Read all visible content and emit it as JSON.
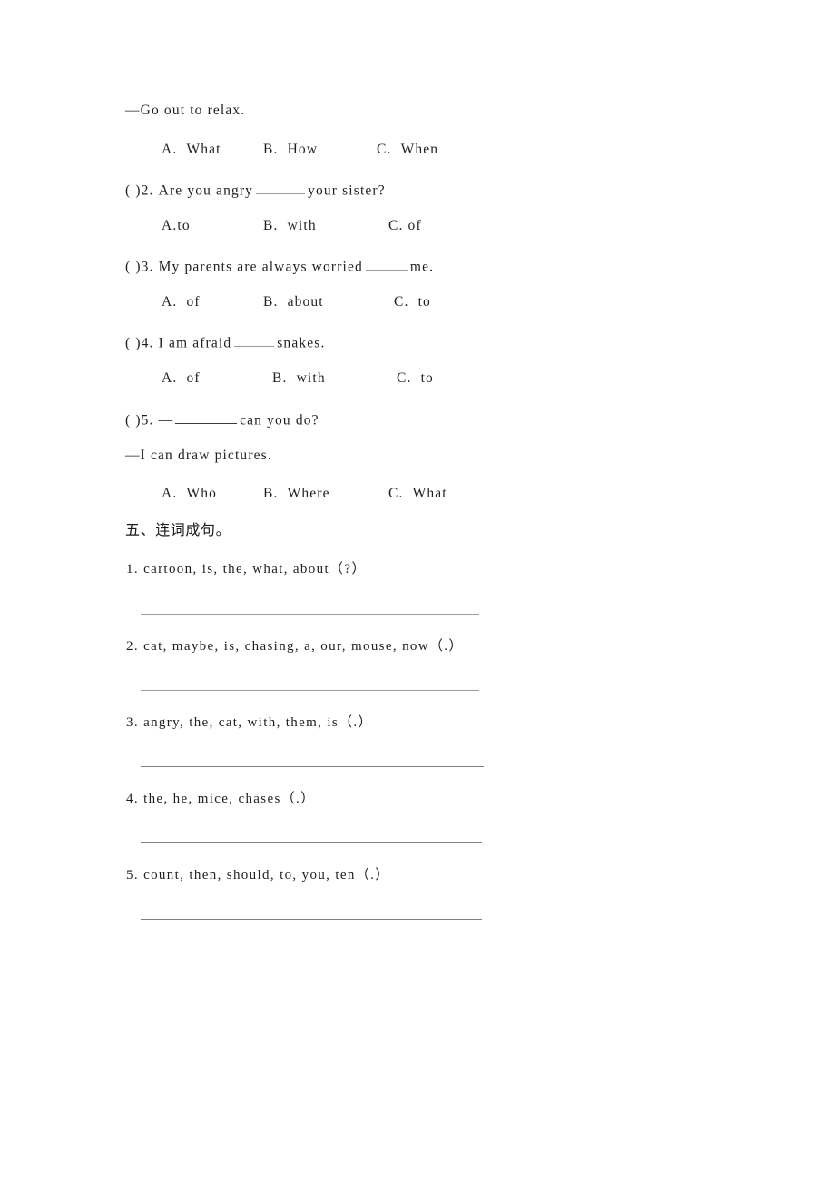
{
  "document": {
    "type": "worksheet",
    "language_mix": "English with Chinese section heading"
  },
  "multiple_choice": {
    "answer_line_1": "—Go out to relax.",
    "questions": [
      {
        "id": "q1-options",
        "options": [
          {
            "letter": "A.",
            "text": "What"
          },
          {
            "letter": "B.",
            "text": "How"
          },
          {
            "letter": "C.",
            "text": "When"
          }
        ]
      },
      {
        "id": "q2",
        "marker": "(  )2.",
        "before_blank": "Are you angry",
        "after_blank": "your sister?",
        "options": [
          {
            "letter": "A.",
            "text": "to"
          },
          {
            "letter": "B.",
            "text": "with"
          },
          {
            "letter": "C.",
            "text": "of"
          }
        ]
      },
      {
        "id": "q3",
        "marker": "(  )3.",
        "before_blank": "My parents are always worried",
        "after_blank": "me.",
        "options": [
          {
            "letter": "A.",
            "text": "of"
          },
          {
            "letter": "B.",
            "text": "about"
          },
          {
            "letter": "C.",
            "text": "to"
          }
        ]
      },
      {
        "id": "q4",
        "marker": "(  )4.",
        "before_blank": "I am afraid",
        "after_blank": "snakes.",
        "options": [
          {
            "letter": "A.",
            "text": "of"
          },
          {
            "letter": "B.",
            "text": "with"
          },
          {
            "letter": "C.",
            "text": "to"
          }
        ]
      },
      {
        "id": "q5",
        "marker": "(  )5.",
        "before_blank": "—",
        "after_blank": "can you do?",
        "answer_line": "—I can draw pictures.",
        "options": [
          {
            "letter": "A.",
            "text": "Who"
          },
          {
            "letter": "B.",
            "text": "Where"
          },
          {
            "letter": "C.",
            "text": "What"
          }
        ]
      }
    ]
  },
  "word_order_section": {
    "heading": "五、连词成句。",
    "items": [
      {
        "number": "1.",
        "words": "cartoon, is, the, what, about（?）"
      },
      {
        "number": "2.",
        "words": "cat, maybe, is, chasing, a, our, mouse, now（.）"
      },
      {
        "number": "3.",
        "words": "angry, the, cat, with, them, is（.）"
      },
      {
        "number": "4.",
        "words": "the, he, mice, chases（.）"
      },
      {
        "number": "5.",
        "words": "count, then, should, to, you, ten（.）"
      }
    ]
  }
}
